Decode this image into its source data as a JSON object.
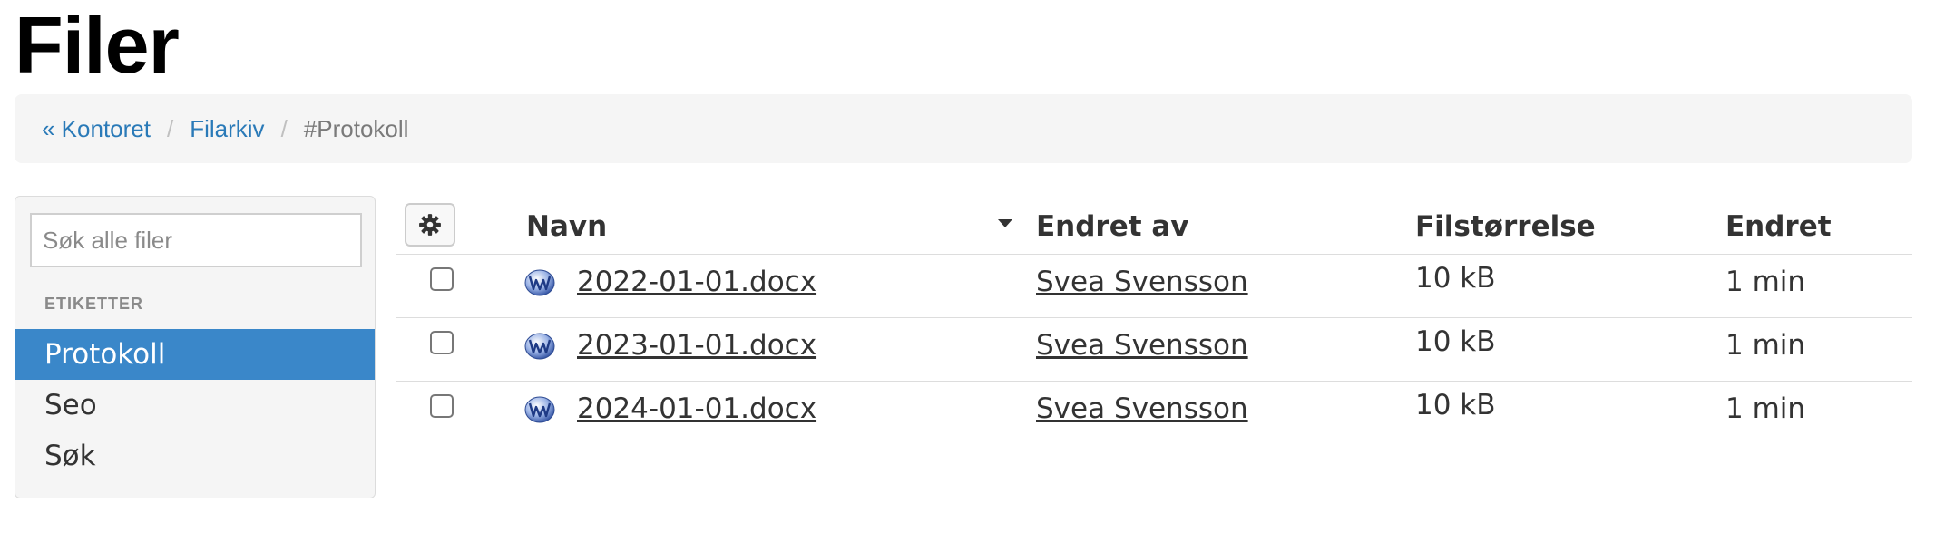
{
  "page": {
    "title": "Filer"
  },
  "breadcrumb": {
    "items": [
      {
        "label": "« Kontoret"
      },
      {
        "label": "Filarkiv"
      }
    ],
    "separator": "/",
    "current": "#Protokoll"
  },
  "sidebar": {
    "search_placeholder": "Søk alle filer",
    "search_value": "",
    "tags_heading": "ETIKETTER",
    "tags": [
      {
        "label": "Protokoll",
        "active": true
      },
      {
        "label": "Seo",
        "active": false
      },
      {
        "label": "Søk",
        "active": false
      }
    ]
  },
  "table": {
    "columns": {
      "name": "Navn",
      "changed_by": "Endret av",
      "size": "Filstørrelse",
      "changed": "Endret"
    },
    "sort_column": "name",
    "rows": [
      {
        "name": "2022-01-01.docx",
        "changed_by": "Svea Svensson",
        "size": "10 kB",
        "changed": "1 min",
        "icon": "word-doc-icon"
      },
      {
        "name": "2023-01-01.docx",
        "changed_by": "Svea Svensson",
        "size": "10 kB",
        "changed": "1 min",
        "icon": "word-doc-icon"
      },
      {
        "name": "2024-01-01.docx",
        "changed_by": "Svea Svensson",
        "size": "10 kB",
        "changed": "1 min",
        "icon": "word-doc-icon"
      }
    ]
  },
  "colors": {
    "link": "#2a7ab8",
    "active_tag_bg": "#3a87c9",
    "panel_bg": "#f5f5f5",
    "word_icon": "#3b5ba9"
  }
}
